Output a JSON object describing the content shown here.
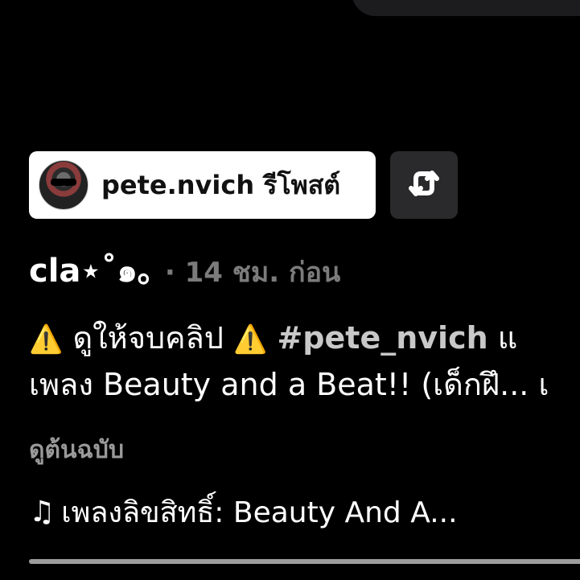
{
  "repost": {
    "username": "pete.nvich",
    "action": "รีโพสต์",
    "button_icon": "repost-icon"
  },
  "post": {
    "author": "cla⋆˚๑｡",
    "separator": "·",
    "time": "14 ชม. ก่อน",
    "caption_line1": {
      "warn1": "⚠️",
      "text1": "ดูให้จบคลิป",
      "warn2": "⚠️",
      "hashtag": "#pete_nvich",
      "text2": "แ"
    },
    "caption_line2": "เพลง Beauty and a Beat!! (เด็กฝึ... เ",
    "see_original": "ดูต้นฉบับ",
    "music_icon": "♫",
    "music": "เพลงลิขสิทธิ์: Beauty And A..."
  },
  "playback": {
    "progress": 1.0
  },
  "colors": {
    "background": "#000000",
    "chip": "#ffffff",
    "muted_text": "#7b7b7b",
    "progress": "#9c9c9c"
  }
}
